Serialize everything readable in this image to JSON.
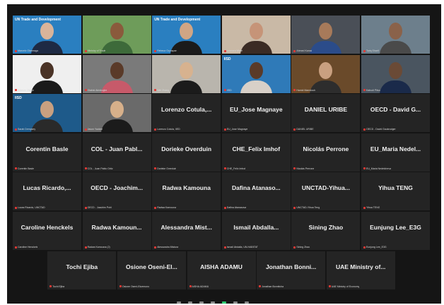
{
  "meeting": {
    "video_tiles": [
      {
        "label": "Marcelo Olarreaga",
        "bg": "#2a7fc0",
        "skin": "#d9b49a",
        "shirt": "#1e2a44",
        "logo": "UN Trade and Development"
      },
      {
        "label": "Ministry of Trade",
        "bg": "#6e9c5a",
        "skin": "#8a5a3c",
        "shirt": "#3d6a3a",
        "logo": ""
      },
      {
        "label": "Rebeca Grynspan",
        "bg": "#2a7fc0",
        "skin": "#d0a584",
        "shirt": "#1b1b1b",
        "logo": "UN Trade and Development"
      },
      {
        "label": "Leonora Walet",
        "bg": "#c9b9a6",
        "skin": "#c69478",
        "shirt": "#3b2b24",
        "logo": ""
      },
      {
        "label": "Ahmed Kamal",
        "bg": "#4a4f57",
        "skin": "#a77a5a",
        "shirt": "#2b4c8a",
        "logo": ""
      },
      {
        "label": "Tariq Sharif",
        "bg": "#6d7f8c",
        "skin": "#8a624a",
        "shirt": "#4a4a4a",
        "logo": ""
      },
      {
        "label": "Adaeze Okoye",
        "bg": "#efefef",
        "skin": "#4a3326",
        "shirt": "#1a1a1a",
        "logo": ""
      },
      {
        "label": "Olabisi Akinkugbe",
        "bg": "#7a7a7a",
        "skin": "#5a3a28",
        "shirt": "#c75a6a",
        "logo": ""
      },
      {
        "label": "Wei Zhang",
        "bg": "#b9b5ad",
        "skin": "#d7b28f",
        "shirt": "#1b1b1b",
        "logo": ""
      },
      {
        "label": "IISD",
        "bg": "#2f7ab8",
        "skin": "#5a3a28",
        "shirt": "#d8d0c8",
        "logo": "IISD"
      },
      {
        "label": "Hamid Mamdouh",
        "bg": "#6a4a2a",
        "skin": "#c9a080",
        "shirt": "#2d2d2d",
        "logo": ""
      },
      {
        "label": "Kahudi Pitso",
        "bg": "#4a5560",
        "skin": "#6a4a36",
        "shirt": "#1a2a4a",
        "logo": ""
      },
      {
        "label": "Sarah Dempsey",
        "bg": "#1e5a8a",
        "skin": "#c9a080",
        "shirt": "#2a2a2a",
        "logo": "IISD"
      },
      {
        "label": "Jason Yackee",
        "bg": "#6a6a6a",
        "skin": "#d7b08a",
        "shirt": "#1b1b1b",
        "logo": ""
      }
    ],
    "name_tiles": [
      {
        "name": "Lorenzo Cotula,...",
        "label": "Lorenzo Cotula, IIED"
      },
      {
        "name": "EU_Jose Magnaye",
        "label": "EU_Jose Magnaye"
      },
      {
        "name": "DANIEL URIBE",
        "label": "DANIEL URIBE"
      },
      {
        "name": "OECD - David G...",
        "label": "OECD - David Gaukrodger"
      },
      {
        "name": "Corentin Basle",
        "label": "Corentin Basle"
      },
      {
        "name": "COL - Juan Pabl...",
        "label": "COL - Juan Pablo Ortiz"
      },
      {
        "name": "Dorieke Overduin",
        "label": "Dorieke Overduin"
      },
      {
        "name": "CHE_Felix Imhof",
        "label": "CHE_Felix Imhof"
      },
      {
        "name": "Nicolás Perrone",
        "label": "Nicolás Perrone"
      },
      {
        "name": "EU_Maria Nedel...",
        "label": "EU_Maria Nedelcheva"
      },
      {
        "name": "Lucas Ricardo,...",
        "label": "Lucas Ricardo, UNCTAD"
      },
      {
        "name": "OECD - Joachim...",
        "label": "OECD - Joachim Pohl"
      },
      {
        "name": "Radwa Kamouna",
        "label": "Radwa Kamouna"
      },
      {
        "name": "Dafina Atanaso...",
        "label": "Dafina Atanasova"
      },
      {
        "name": "UNCTAD-Yihua...",
        "label": "UNCTAD-Yihua Teng"
      },
      {
        "name": "Yihua TENG",
        "label": "Yihua TENG"
      },
      {
        "name": "Caroline Henckels",
        "label": "Caroline Henckels"
      },
      {
        "name": "Radwa Kamoun...",
        "label": "Radwa Kamouna (2)"
      },
      {
        "name": "Alessandra Mist...",
        "label": "Alessandra Mistura"
      },
      {
        "name": "Ismail Abdalla...",
        "label": "Ismail Abdalla, UN-HABITAT"
      },
      {
        "name": "Sining Zhao",
        "label": "Sining Zhao"
      },
      {
        "name": "Eunjung Lee_E3G",
        "label": "Eunjung Lee_E3G"
      },
      {
        "name": "Tochi Ejiba",
        "label": "Tochi Ejiba"
      },
      {
        "name": "Osione Oseni-El...",
        "label": "Osione Oseni-Eluemuno"
      },
      {
        "name": "AISHA ADAMU",
        "label": "AISHA ADAMU"
      },
      {
        "name": "Jonathan Bonni...",
        "label": "Jonathan Bonnitcha"
      },
      {
        "name": "UAE Ministry of...",
        "label": "UAE Ministry of Economy"
      }
    ]
  },
  "colors": {
    "tile": "#242424",
    "window": "#151515",
    "muted_mic": "#e53935"
  }
}
